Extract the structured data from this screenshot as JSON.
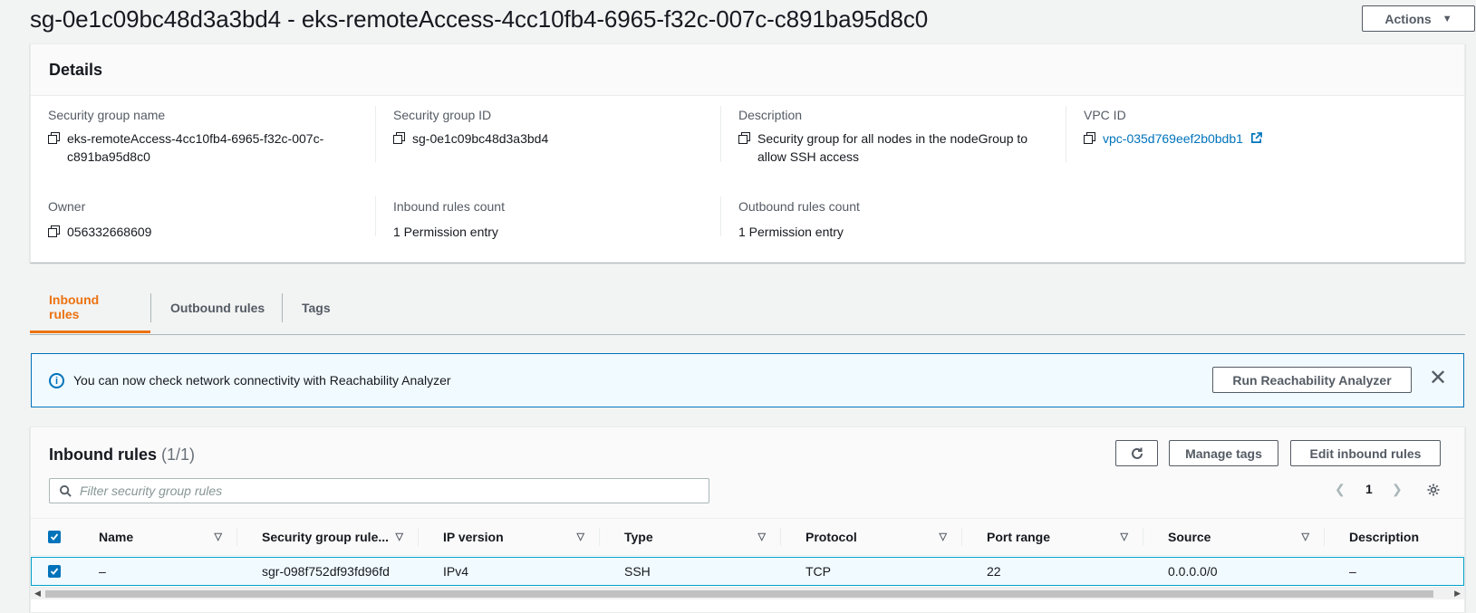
{
  "header": {
    "title": "sg-0e1c09bc48d3a3bd4 - eks-remoteAccess-4cc10fb4-6965-f32c-007c-c891ba95d8c0",
    "actions_label": "Actions"
  },
  "details": {
    "heading": "Details",
    "sg_name_label": "Security group name",
    "sg_name_line1": "eks-remoteAccess-4cc10fb4-6965-f32c-007c-",
    "sg_name_line2": "c891ba95d8c0",
    "sg_id_label": "Security group ID",
    "sg_id": "sg-0e1c09bc48d3a3bd4",
    "description_label": "Description",
    "description_line1": "Security group for all nodes in the nodeGroup to",
    "description_line2": "allow SSH access",
    "vpc_label": "VPC ID",
    "vpc_id": "vpc-035d769eef2b0bdb1",
    "owner_label": "Owner",
    "owner": "056332668609",
    "inbound_count_label": "Inbound rules count",
    "inbound_count": "1 Permission entry",
    "outbound_count_label": "Outbound rules count",
    "outbound_count": "1 Permission entry"
  },
  "tabs": [
    {
      "label": "Inbound rules",
      "active": true
    },
    {
      "label": "Outbound rules",
      "active": false
    },
    {
      "label": "Tags",
      "active": false
    }
  ],
  "alert": {
    "text": "You can now check network connectivity with Reachability Analyzer",
    "button_label": "Run Reachability Analyzer"
  },
  "rules": {
    "title": "Inbound rules",
    "count": "(1/1)",
    "manage_tags_label": "Manage tags",
    "edit_label": "Edit inbound rules",
    "filter_placeholder": "Filter security group rules",
    "page": "1",
    "columns": [
      "Name",
      "Security group rule...",
      "IP version",
      "Type",
      "Protocol",
      "Port range",
      "Source",
      "Description"
    ],
    "rows": [
      [
        "–",
        "sgr-098f752df93fd96fd",
        "IPv4",
        "SSH",
        "TCP",
        "22",
        "0.0.0.0/0",
        "–"
      ]
    ]
  },
  "colors": {
    "accent_orange": "#ec7211",
    "link_blue": "#0073bb"
  }
}
